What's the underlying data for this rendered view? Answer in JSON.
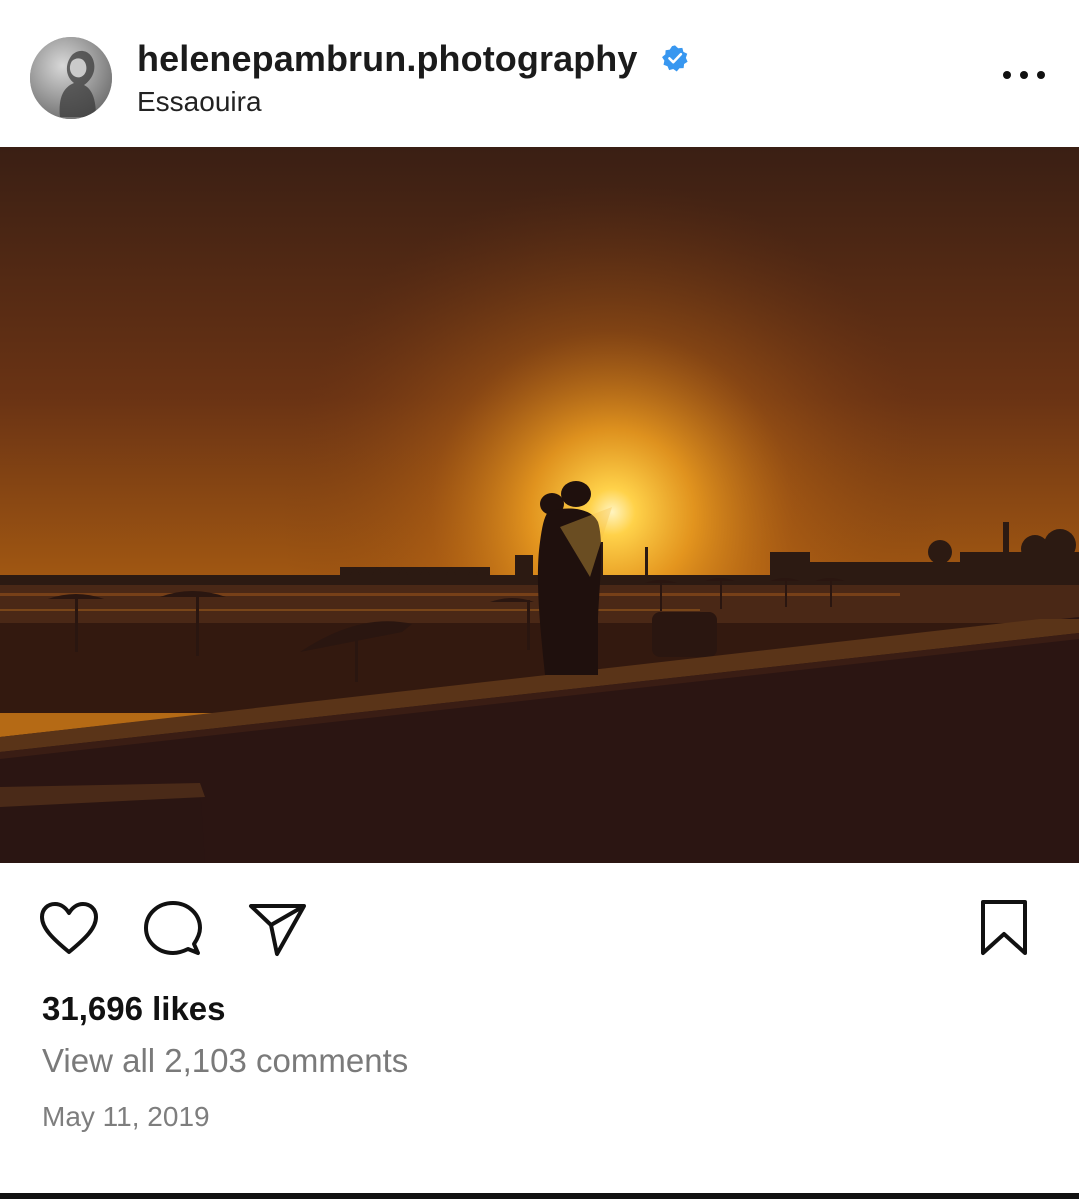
{
  "post": {
    "username": "helenepambrun.photography",
    "location": "Essaouira",
    "likes": "31,696 likes",
    "comments_link": "View all 2,103 comments",
    "date": "May 11, 2019"
  },
  "icons": {
    "verified": "verified-badge-icon",
    "more": "more-options-icon",
    "like": "heart-icon",
    "comment": "comment-icon",
    "share": "send-icon",
    "save": "bookmark-icon"
  },
  "colors": {
    "verified_blue": "#3897f0",
    "sun": "#f2a52a",
    "sky_dark": "#4a2612"
  }
}
